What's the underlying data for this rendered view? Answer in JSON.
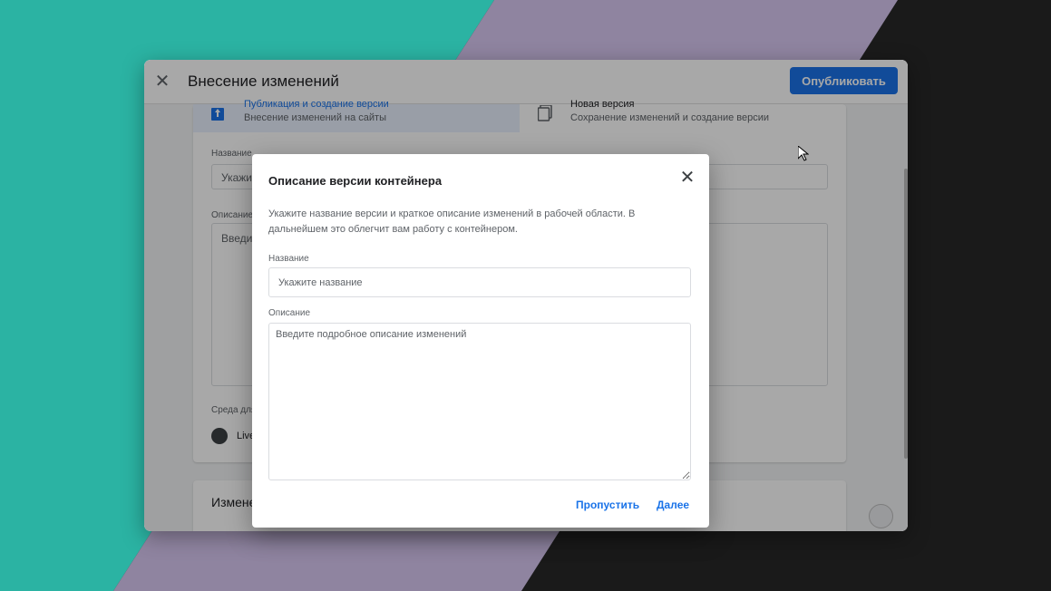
{
  "header": {
    "title": "Внесение изменений",
    "publish_label": "Опубликовать"
  },
  "background_form": {
    "option_publish": {
      "title": "Публикация и создание версии",
      "subtitle": "Внесение изменений на сайты"
    },
    "option_new_version": {
      "title": "Новая версия",
      "subtitle": "Сохранение изменений и создание версии"
    },
    "name_label_partial": "Название",
    "name_value_partial": "Укажи",
    "desc_label_partial": "Описание",
    "desc_value_partial": "Введит",
    "env_label_partial": "Среда для",
    "env_value_partial": "Live",
    "section_partial": "Измене"
  },
  "dialog": {
    "title": "Описание версии контейнера",
    "description": "Укажите название версии и краткое описание изменений в рабочей области. В дальнейшем это облегчит вам работу с контейнером.",
    "name_label": "Название",
    "name_placeholder": "Укажите название",
    "description_label": "Описание",
    "description_placeholder": "Введите подробное описание изменений",
    "skip_label": "Пропустить",
    "next_label": "Далее"
  },
  "colors": {
    "teal": "#2bb3a3",
    "lavender": "#8f84a0",
    "dark": "#1a1a1a",
    "accent": "#1a73e8"
  },
  "icons": {
    "close": "close-icon",
    "publish": "publish-version-icon",
    "copy": "copy-version-icon",
    "cursor": "mouse-cursor-icon",
    "globe": "globe-icon"
  }
}
